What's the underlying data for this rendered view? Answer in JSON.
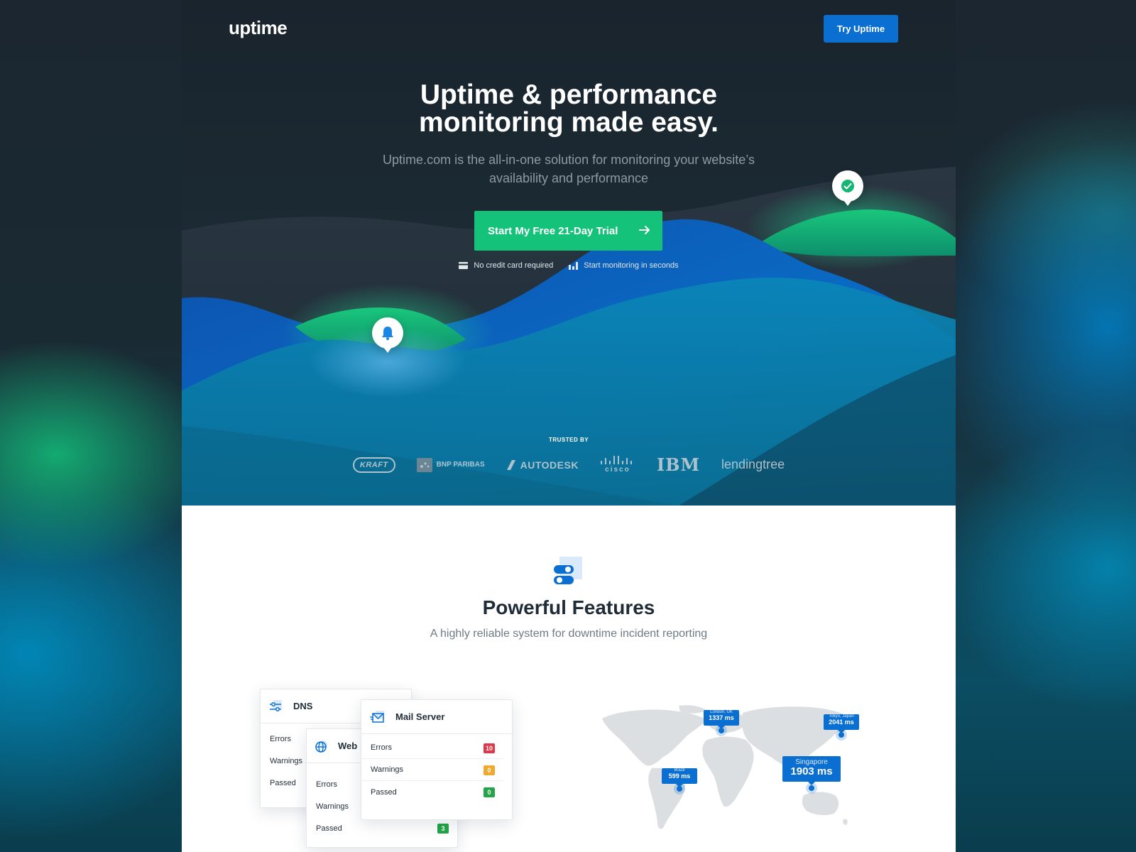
{
  "nav": {
    "logo": "uptime",
    "try_label": "Try Uptime"
  },
  "hero": {
    "headline_line1": "Uptime & performance",
    "headline_line2": "monitoring made easy.",
    "sub_line1": "Uptime.com is the all-in-one solution for monitoring your website’s",
    "sub_line2": "availability and performance",
    "cta_label": "Start My Free 21-Day Trial",
    "perks": [
      {
        "icon": "credit-card-icon",
        "label": "No credit card required"
      },
      {
        "icon": "bar-chart-icon",
        "label": "Start monitoring in seconds"
      }
    ]
  },
  "trusted": {
    "label": "TRUSTED BY",
    "brands": [
      "KRAFT",
      "BNP PARIBAS",
      "AUTODESK",
      "cisco",
      "IBM",
      "lendingtree"
    ]
  },
  "features": {
    "title": "Powerful Features",
    "subtitle": "A highly reliable system for downtime incident reporting",
    "cards": {
      "dns": {
        "title": "DNS",
        "rows": [
          "Errors",
          "Warnings",
          "Passed"
        ]
      },
      "web": {
        "title": "Web",
        "rows": [
          "Errors",
          "Warnings",
          "Passed"
        ],
        "passed_count": "3"
      },
      "mail": {
        "title": "Mail Server",
        "rows": [
          {
            "label": "Errors",
            "count": "10",
            "color": "#e0364a"
          },
          {
            "label": "Warnings",
            "count": "0",
            "color": "#f0a92e"
          },
          {
            "label": "Passed",
            "count": "0",
            "color": "#23a548"
          }
        ]
      }
    },
    "map": {
      "locations": [
        {
          "city": "London, UK",
          "ms": "1337 ms"
        },
        {
          "city": "Tokyo, Japan",
          "ms": "2041 ms"
        },
        {
          "city": "Brazil",
          "ms": "599 ms"
        },
        {
          "city": "Singapore",
          "ms": "1903 ms"
        }
      ]
    }
  },
  "colors": {
    "accent_green": "#15c27a",
    "accent_blue": "#0a6fd0",
    "hero_dark": "#1a242d"
  }
}
